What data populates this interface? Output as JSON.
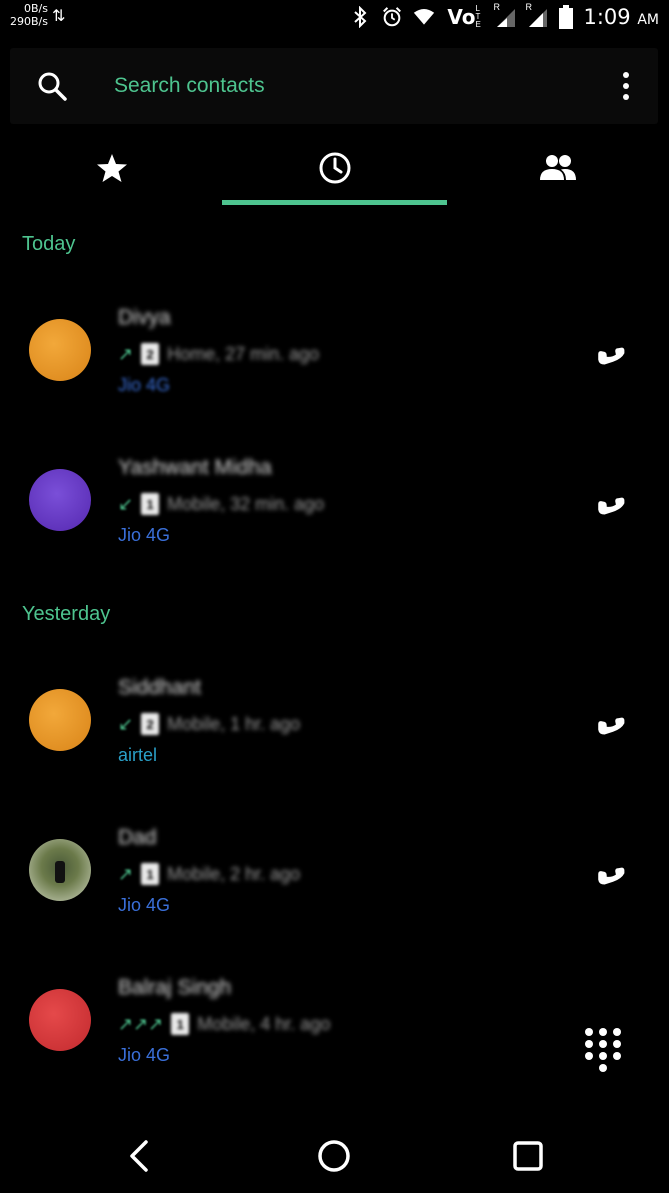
{
  "status_bar": {
    "speed_down": "0B/s",
    "speed_up": "290B/s",
    "network_arrows": "⇅",
    "time": "1:09",
    "ampm": "AM",
    "volte": "Vo",
    "sim1_roaming": "R",
    "sim2_roaming": "R",
    "icons": [
      "bluetooth-icon",
      "alarm-icon",
      "wifi-icon",
      "volte-icon",
      "signal-icon",
      "signal-icon",
      "battery-icon"
    ]
  },
  "search": {
    "placeholder": "Search contacts"
  },
  "tabs": [
    {
      "name": "favorites",
      "icon": "star-icon"
    },
    {
      "name": "recents",
      "icon": "clock-icon",
      "selected": true
    },
    {
      "name": "contacts",
      "icon": "people-icon"
    }
  ],
  "sections": {
    "today": "Today",
    "yesterday": "Yesterday"
  },
  "calls": [
    {
      "name": "Divya",
      "direction": "↗",
      "sim": "2",
      "detail": "Home, 27 min. ago",
      "carrier": "Jio 4G",
      "carrier_color": "#3a6fd8",
      "avatar_color": "#e8962a"
    },
    {
      "name": "Yashwant Midha",
      "direction": "↙",
      "sim": "1",
      "detail": "Mobile, 32 min. ago",
      "carrier": "Jio 4G",
      "carrier_color": "#3a6fd8",
      "avatar_color": "#6a3fc8"
    },
    {
      "name": "Siddhant",
      "direction": "↙",
      "sim": "2",
      "detail": "Mobile, 1 hr. ago",
      "carrier": "airtel",
      "carrier_color": "#2aa0c8",
      "avatar_color": "#e8962a"
    },
    {
      "name": "Dad",
      "direction": "↗",
      "sim": "1",
      "detail": "Mobile, 2 hr. ago",
      "carrier": "Jio 4G",
      "carrier_color": "#3a6fd8",
      "avatar_color": "#5a7040"
    },
    {
      "name": "Balraj Singh",
      "direction": "↗↗↗",
      "sim": "1",
      "detail": "Mobile, 4 hr. ago",
      "carrier": "Jio 4G",
      "carrier_color": "#3a6fd8",
      "avatar_color": "#d8393c"
    }
  ],
  "colors": {
    "accent": "#4ec48f",
    "background": "#000000"
  }
}
